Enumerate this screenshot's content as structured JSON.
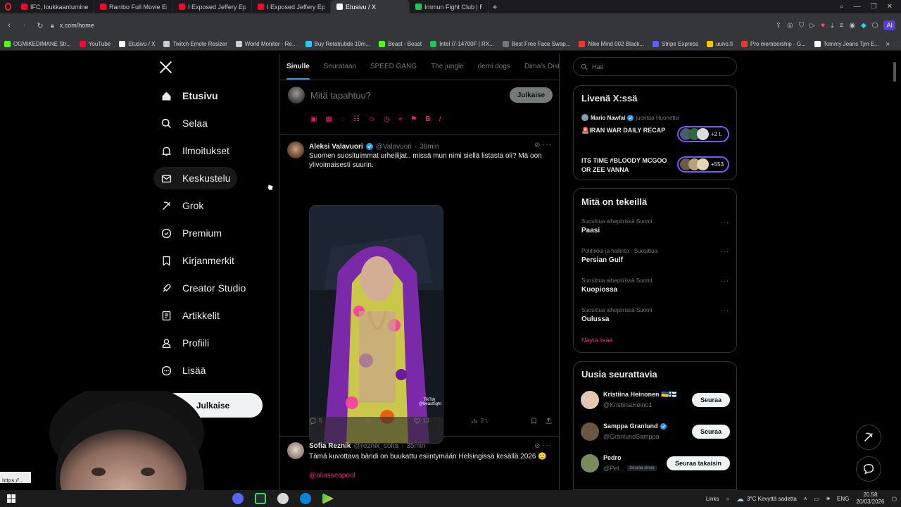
{
  "browser": {
    "tabs": [
      {
        "label": "IFC, loukkaantuminen & I",
        "color": "#ff0033",
        "active": false
      },
      {
        "label": "Rambo Full Movie English",
        "color": "#ff0033",
        "active": false
      },
      {
        "label": "I Exposed Jeffery Epstein",
        "color": "#ff0033",
        "active": false
      },
      {
        "label": "I Exposed Jeffery Epstein",
        "color": "#ff0033",
        "active": false
      },
      {
        "label": "Etusivu / X",
        "color": "#ffffff",
        "active": true
      },
      {
        "label": "Immun Fight Club | Ruutu",
        "color": "#21c35a",
        "active": false
      }
    ],
    "new_tab_symbol": "+",
    "url": "x.com/home",
    "bookmarks": [
      {
        "label": "OGMIKEDIMANE Str...",
        "color": "#53fc18"
      },
      {
        "label": "YouTube",
        "color": "#ff0033"
      },
      {
        "label": "Etusivu / X",
        "color": "#ffffff"
      },
      {
        "label": "Twitch Emote Resizer",
        "color": "#cccccc"
      },
      {
        "label": "World Monitor - Re...",
        "color": "#cccccc"
      },
      {
        "label": "Buy Retatrutide 10m...",
        "color": "#35c4f0"
      },
      {
        "label": "Beast - Beast",
        "color": "#53fc18"
      },
      {
        "label": "Intel i7-14700F | RX...",
        "color": "#21c35a"
      },
      {
        "label": "Best Free Face Swap...",
        "color": "#777777"
      },
      {
        "label": "Nike Mind 002 Black...",
        "color": "#e63b2e"
      },
      {
        "label": "Stripe Express",
        "color": "#635bff"
      },
      {
        "label": "uuno.fi",
        "color": "#f5c400"
      },
      {
        "label": "Pro membership - G...",
        "color": "#e63b2e"
      },
      {
        "label": "Tommy Jeans Tjm E...",
        "color": "#ffffff"
      }
    ]
  },
  "nav": {
    "logo": "X",
    "items": [
      {
        "label": "Etusivu",
        "icon": "home-icon"
      },
      {
        "label": "Selaa",
        "icon": "search-icon"
      },
      {
        "label": "Ilmoitukset",
        "icon": "bell-icon"
      },
      {
        "label": "Keskustelu",
        "icon": "mail-icon"
      },
      {
        "label": "Grok",
        "icon": "grok-icon"
      },
      {
        "label": "Premium",
        "icon": "premium-icon"
      },
      {
        "label": "Kirjanmerkit",
        "icon": "bookmark-icon"
      },
      {
        "label": "Creator Studio",
        "icon": "rocket-icon"
      },
      {
        "label": "Artikkelit",
        "icon": "article-icon"
      },
      {
        "label": "Profiili",
        "icon": "profile-icon"
      },
      {
        "label": "Lisää",
        "icon": "more-circle-icon"
      }
    ],
    "post_button": "Julkaise"
  },
  "timeline": {
    "tabs": [
      "Sinulle",
      "Seurataan",
      "SPEED GANG",
      "The jungle",
      "demi dogs",
      "Dima's Dist"
    ],
    "composer": {
      "placeholder": "Mitä tapahtuu?",
      "post_button": "Julkaise"
    },
    "tweets": [
      {
        "name": "Aleksi Valavuori",
        "handle": "@Valavuori",
        "time": "38min",
        "text": "Suomen suosituimmat urheilijat.. missä mun nimi siellä listasta oli? Mä oon ylivoimaisesti suurin.",
        "media_watermark": "TikTok @beastfight",
        "replies": "5",
        "likes": "13",
        "views": "2 t."
      },
      {
        "name": "Sofia Reznik",
        "handle": "@reznik_sofia",
        "time": "35min",
        "text": "Tämä kuvottava bändi on buukattu esiintymään Helsingissä kesällä 2026 🙂",
        "mention": "@aliasseapool"
      }
    ]
  },
  "sidebar": {
    "search_placeholder": "Hae",
    "live": {
      "title": "Livenä X:ssä",
      "host": "Mario Nawfal",
      "host_note": "juontaa Huonetta",
      "items": [
        {
          "title": "🚨IRAN WAR DAILY RECAP",
          "count": "+2 t."
        },
        {
          "title": "ITS TIME #BLOODY MCGOO OR ZEE VANNA",
          "count": "+553"
        }
      ]
    },
    "trends": {
      "title": "Mitä on tekeillä",
      "items": [
        {
          "sub": "Suosittua aihepiirissä Suomi",
          "name": "Paasi"
        },
        {
          "sub": "Politiikka ja hallinto · Suosittua",
          "name": "Persian Gulf"
        },
        {
          "sub": "Suosittua aihepiirissä Suomi",
          "name": "Kuopiossa"
        },
        {
          "sub": "Suosittua aihepiirissä Suomi",
          "name": "Oulussa"
        }
      ],
      "show_more": "Näytä lisää"
    },
    "follow": {
      "title": "Uusia seurattavia",
      "items": [
        {
          "name": "Kristiina Heinonen 🇺🇦🇫🇮",
          "handle": "@KristiinaHeino1",
          "button": "Seuraa"
        },
        {
          "name": "Samppa Granlund",
          "handle": "@GranlundSamppa",
          "button": "Seuraa"
        },
        {
          "name": "Pedro",
          "handle": "@Pet...",
          "badge": "Seuraa sinua",
          "button": "Seuraa takaisin"
        }
      ]
    }
  },
  "status_url": "https://...",
  "taskbar": {
    "links_label": "Links",
    "weather": "3°C  Kevyttä sadetta",
    "lang": "ENG",
    "time": "20.58",
    "date": "20/03/2026"
  },
  "colors": {
    "accent": "#1d9bf0",
    "link": "#f91880",
    "verified": "#1d9bf0"
  }
}
